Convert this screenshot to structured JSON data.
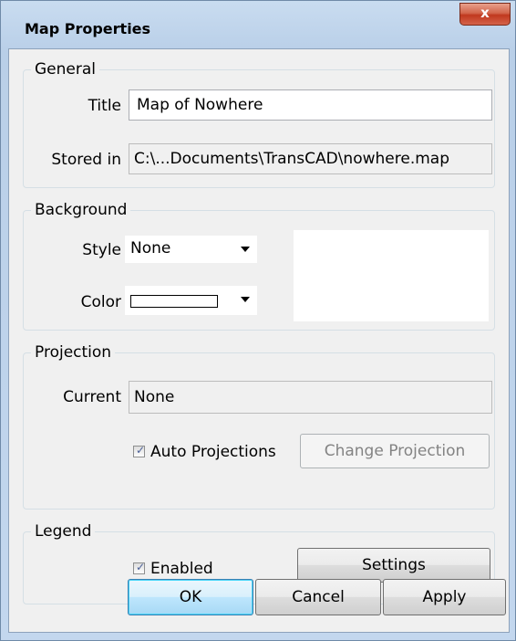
{
  "window": {
    "title": "Map Properties",
    "close_label": "x"
  },
  "general": {
    "legend": "General",
    "title_label": "Title",
    "title_value": "Map of Nowhere",
    "stored_label": "Stored in",
    "stored_value": "C:\\...Documents\\TransCAD\\nowhere.map"
  },
  "background": {
    "legend": "Background",
    "style_label": "Style",
    "style_value": "None",
    "color_label": "Color",
    "color_value": "#ffffff"
  },
  "projection": {
    "legend": "Projection",
    "current_label": "Current",
    "current_value": "None",
    "auto_label": "Auto Projections",
    "auto_checked": true,
    "change_label": "Change Projection"
  },
  "legend_group": {
    "legend": "Legend",
    "enabled_label": "Enabled",
    "enabled_checked": true,
    "settings_label": "Settings"
  },
  "footer": {
    "ok_label": "OK",
    "cancel_label": "Cancel",
    "apply_label": "Apply"
  },
  "icons": {
    "check": "checkmark",
    "close": "close-x",
    "dropdown": "triangle-down"
  }
}
